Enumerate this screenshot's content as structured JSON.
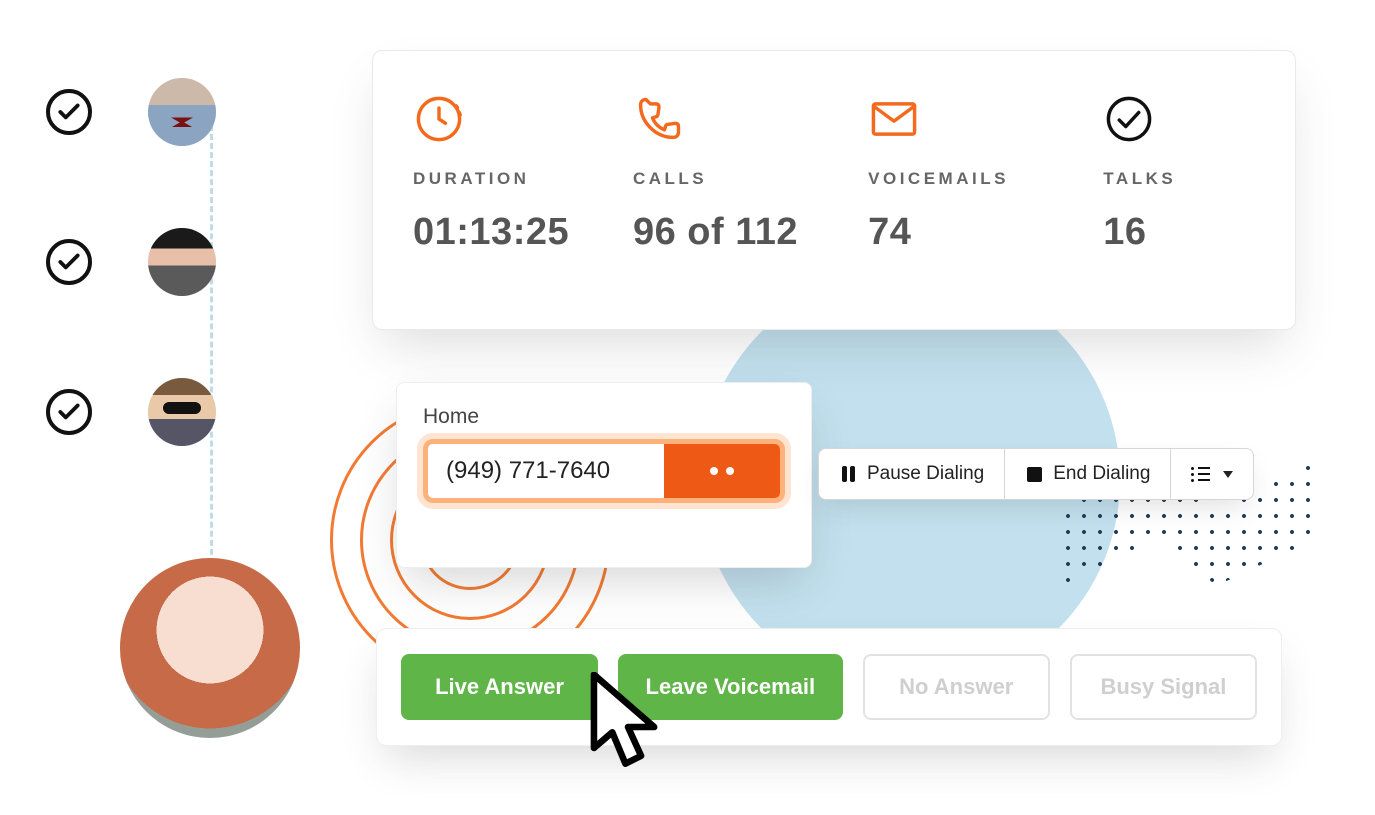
{
  "stats": {
    "duration": {
      "label": "DURATION",
      "value": "01:13:25"
    },
    "calls": {
      "label": "CALLS",
      "value": "96 of 112"
    },
    "voicemails": {
      "label": "VOICEMAILS",
      "value": "74"
    },
    "talks": {
      "label": "TALKS",
      "value": "16"
    }
  },
  "dialer": {
    "type_label": "Home",
    "phone": "(949) 771-7640"
  },
  "toolbar": {
    "pause": "Pause Dialing",
    "end": "End Dialing"
  },
  "dispositions": {
    "live": "Live Answer",
    "voicemail": "Leave Voicemail",
    "noanswer": "No Answer",
    "busy": "Busy Signal"
  }
}
